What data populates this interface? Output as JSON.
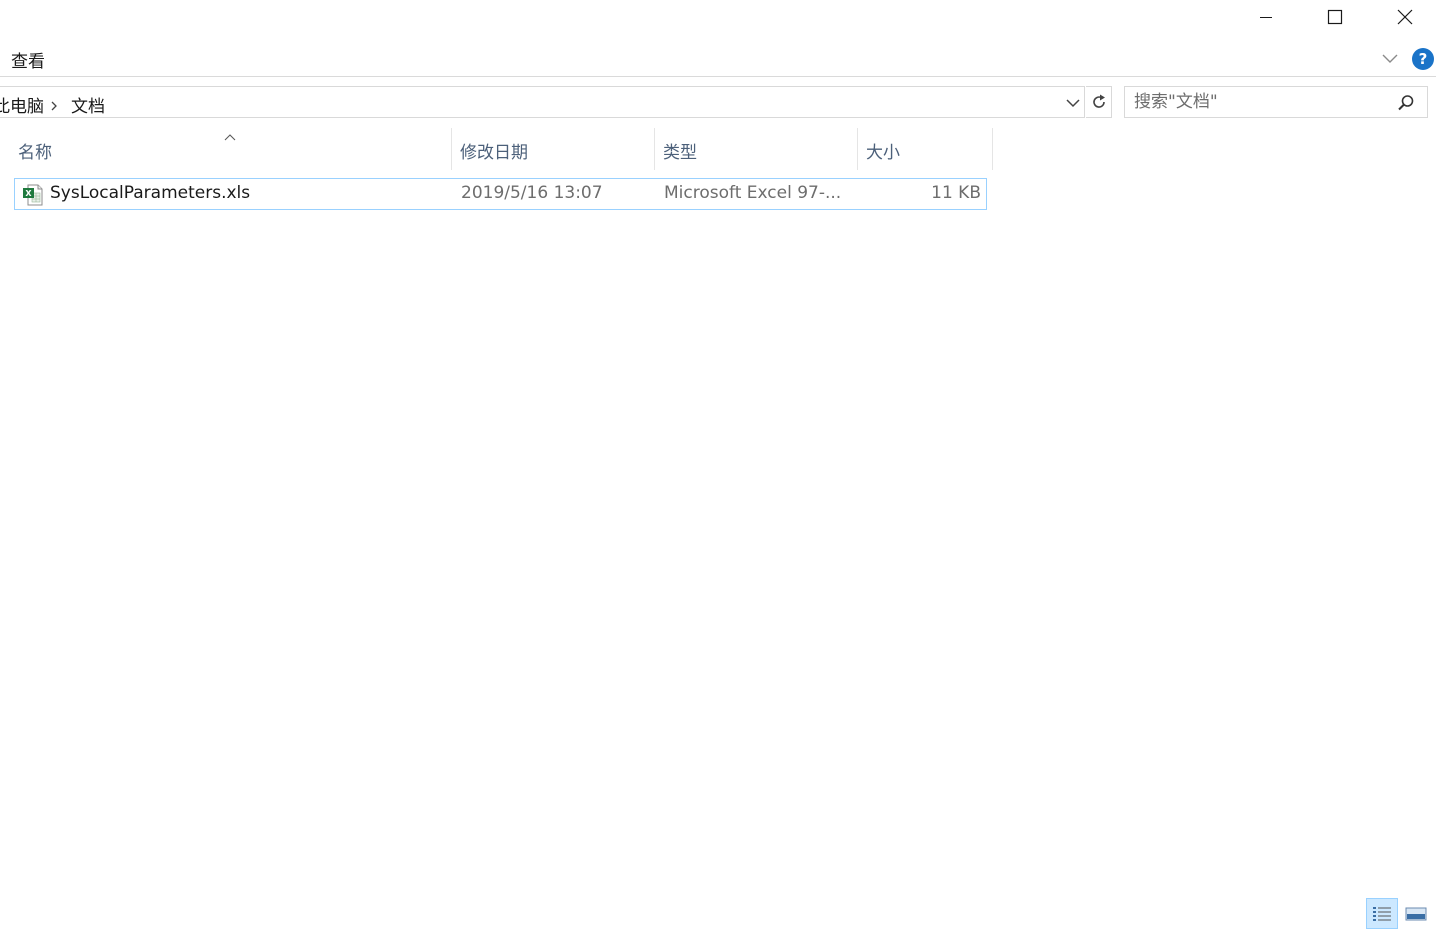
{
  "window_controls": {
    "minimize": "minimize-icon",
    "maximize": "maximize-icon",
    "close": "close-icon"
  },
  "ribbon": {
    "tab_view": "查看"
  },
  "address_bar": {
    "crumbs": [
      "此电脑",
      "文档"
    ]
  },
  "search": {
    "placeholder": "搜索\"文档\""
  },
  "columns": {
    "name": "名称",
    "date_modified": "修改日期",
    "type": "类型",
    "size": "大小"
  },
  "files": [
    {
      "name": "SysLocalParameters.xls",
      "date_modified": "2019/5/16 13:07",
      "type": "Microsoft Excel 97-...",
      "size": "11 KB",
      "icon": "excel-file-icon"
    }
  ],
  "colors": {
    "selection_border": "#99d1ff",
    "header_text": "#4c607a",
    "help_blue": "#1a73c8"
  }
}
